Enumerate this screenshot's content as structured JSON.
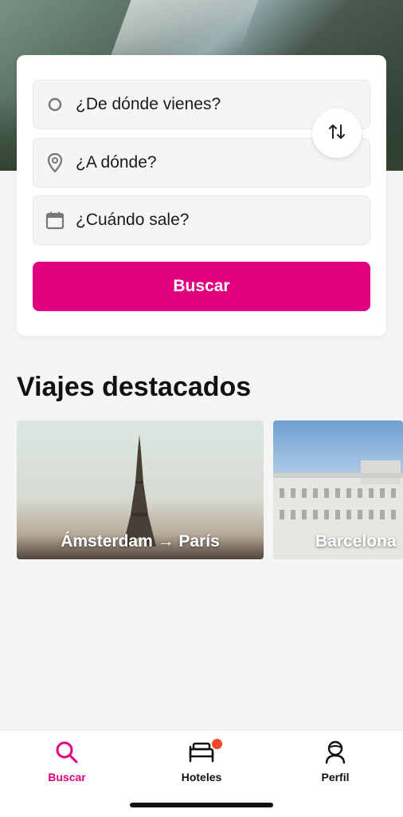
{
  "search": {
    "origin_placeholder": "¿De dónde vienes?",
    "destination_placeholder": "¿A dónde?",
    "date_placeholder": "¿Cuándo sale?",
    "button_label": "Buscar"
  },
  "featured": {
    "title": "Viajes destacados",
    "trips": [
      {
        "label": "Ámsterdam → París"
      },
      {
        "label": "Barcelona"
      }
    ]
  },
  "tabbar": {
    "tabs": [
      {
        "label": "Buscar",
        "icon": "search-icon",
        "active": true
      },
      {
        "label": "Hoteles",
        "icon": "bed-icon",
        "badge": true
      },
      {
        "label": "Perfil",
        "icon": "profile-icon"
      }
    ]
  },
  "colors": {
    "accent": "#e0007f",
    "badge": "#f24a2c"
  }
}
